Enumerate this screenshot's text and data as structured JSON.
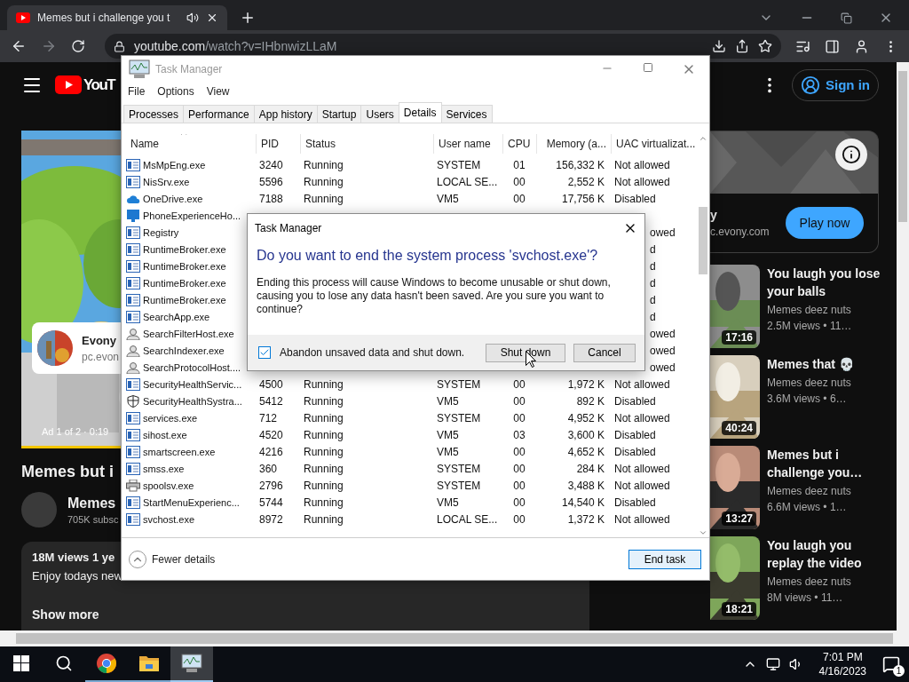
{
  "browser": {
    "tab": {
      "title": "Memes but i challenge you t"
    },
    "url": {
      "host": "youtube.com",
      "path": "/watch?v=IHbnwizLLaM"
    }
  },
  "youtube": {
    "logo": "YouT",
    "sign_in": "Sign in",
    "ad": {
      "advertiser": "Evony",
      "domain": "pc.evon",
      "counter": "Ad 1 of 2 · 0:19"
    },
    "video": {
      "title": "Memes but i",
      "channel": "Memes",
      "subscribers": "705K subsc",
      "stats": "18M views  1 ye",
      "description": "Enjoy todays new",
      "show_more": "Show more"
    },
    "side_ad": {
      "name": "y",
      "domain": "c.evony.com",
      "button": "Play now"
    },
    "recommendations": [
      {
        "title": "You laugh you lose your balls",
        "channel": "Memes deez nuts",
        "meta": "2.5M views  • 11…",
        "duration": "17:16"
      },
      {
        "title": "Memes that 💀",
        "channel": "Memes deez nuts",
        "meta": "3.6M views  • 6…",
        "duration": "40:24"
      },
      {
        "title": "Memes but i challenge you…",
        "channel": "Memes deez nuts",
        "meta": "6.6M views  • 1…",
        "duration": "13:27"
      },
      {
        "title": "You laugh you replay the video",
        "channel": "Memes deez nuts",
        "meta": "8M views  • 11…",
        "duration": "18:21"
      }
    ]
  },
  "task_manager": {
    "title": "Task Manager",
    "menu": [
      "File",
      "Options",
      "View"
    ],
    "tabs": [
      {
        "label": "Processes",
        "selected": false
      },
      {
        "label": "Performance",
        "selected": false
      },
      {
        "label": "App history",
        "selected": false
      },
      {
        "label": "Startup",
        "selected": false
      },
      {
        "label": "Users",
        "selected": false
      },
      {
        "label": "Details",
        "selected": true
      },
      {
        "label": "Services",
        "selected": false
      }
    ],
    "columns": [
      "Name",
      "PID",
      "Status",
      "User name",
      "CPU",
      "Memory (a...",
      "UAC virtualizat..."
    ],
    "rows": [
      {
        "kind": "app",
        "name": "MsMpEng.exe",
        "pid": "3240",
        "status": "Running",
        "user": "SYSTEM",
        "cpu": "01",
        "memory": "156,332 K",
        "uac": "Not allowed"
      },
      {
        "kind": "app",
        "name": "NisSrv.exe",
        "pid": "5596",
        "status": "Running",
        "user": "LOCAL SE...",
        "cpu": "00",
        "memory": "2,552 K",
        "uac": "Not allowed"
      },
      {
        "kind": "cloud",
        "name": "OneDrive.exe",
        "pid": "7188",
        "status": "Running",
        "user": "VM5",
        "cpu": "00",
        "memory": "17,756 K",
        "uac": "Disabled"
      },
      {
        "kind": "monitor",
        "name": "PhoneExperienceHo..."
      },
      {
        "kind": "app",
        "name": "Registry",
        "uac_tail": "owed"
      },
      {
        "kind": "app",
        "name": "RuntimeBroker.exe",
        "uac_tail": "d"
      },
      {
        "kind": "app",
        "name": "RuntimeBroker.exe",
        "uac_tail": "d"
      },
      {
        "kind": "app",
        "name": "RuntimeBroker.exe",
        "uac_tail": "d"
      },
      {
        "kind": "app",
        "name": "RuntimeBroker.exe",
        "uac_tail": "d"
      },
      {
        "kind": "app",
        "name": "SearchApp.exe",
        "uac_tail": "d"
      },
      {
        "kind": "person",
        "name": "SearchFilterHost.exe",
        "uac_tail": "owed"
      },
      {
        "kind": "person",
        "name": "SearchIndexer.exe",
        "uac_tail": "owed"
      },
      {
        "kind": "person",
        "name": "SearchProtocolHost....",
        "uac_tail": "owed"
      },
      {
        "kind": "app",
        "name": "SecurityHealthServic...",
        "pid": "4500",
        "status": "Running",
        "user": "SYSTEM",
        "cpu": "00",
        "memory": "1,972 K",
        "uac": "Not allowed"
      },
      {
        "kind": "shield",
        "name": "SecurityHealthSystra...",
        "pid": "5412",
        "status": "Running",
        "user": "VM5",
        "cpu": "00",
        "memory": "892 K",
        "uac": "Disabled"
      },
      {
        "kind": "app",
        "name": "services.exe",
        "pid": "712",
        "status": "Running",
        "user": "SYSTEM",
        "cpu": "00",
        "memory": "4,952 K",
        "uac": "Not allowed"
      },
      {
        "kind": "app",
        "name": "sihost.exe",
        "pid": "4520",
        "status": "Running",
        "user": "VM5",
        "cpu": "03",
        "memory": "3,600 K",
        "uac": "Disabled"
      },
      {
        "kind": "app",
        "name": "smartscreen.exe",
        "pid": "4216",
        "status": "Running",
        "user": "VM5",
        "cpu": "00",
        "memory": "4,652 K",
        "uac": "Disabled"
      },
      {
        "kind": "app",
        "name": "smss.exe",
        "pid": "360",
        "status": "Running",
        "user": "SYSTEM",
        "cpu": "00",
        "memory": "284 K",
        "uac": "Not allowed"
      },
      {
        "kind": "printer",
        "name": "spoolsv.exe",
        "pid": "2796",
        "status": "Running",
        "user": "SYSTEM",
        "cpu": "00",
        "memory": "3,488 K",
        "uac": "Not allowed"
      },
      {
        "kind": "app",
        "name": "StartMenuExperienc...",
        "pid": "5744",
        "status": "Running",
        "user": "VM5",
        "cpu": "00",
        "memory": "14,540 K",
        "uac": "Disabled"
      },
      {
        "kind": "app",
        "name": "svchost.exe",
        "pid": "8972",
        "status": "Running",
        "user": "LOCAL SE...",
        "cpu": "00",
        "memory": "1,372 K",
        "uac": "Not allowed"
      }
    ],
    "fewer_details": "Fewer details",
    "end_task": "End task"
  },
  "dialog": {
    "title": "Task Manager",
    "heading": "Do you want to end the system process 'svchost.exe'?",
    "message": "Ending this process will cause Windows to become unusable or shut down, causing you to lose any data hasn't been saved. Are you sure you want to continue?",
    "abandon": {
      "label": "Abandon unsaved data and shut down.",
      "checked": true
    },
    "buttons": [
      "Shut down",
      "Cancel"
    ]
  },
  "taskbar": {
    "apps": [
      {
        "kind": "chrome",
        "active": false
      },
      {
        "kind": "folder",
        "active": false
      },
      {
        "kind": "task-manager",
        "active": true
      }
    ],
    "time": "7:01 PM",
    "date": "4/16/2023",
    "notifications": "1"
  }
}
